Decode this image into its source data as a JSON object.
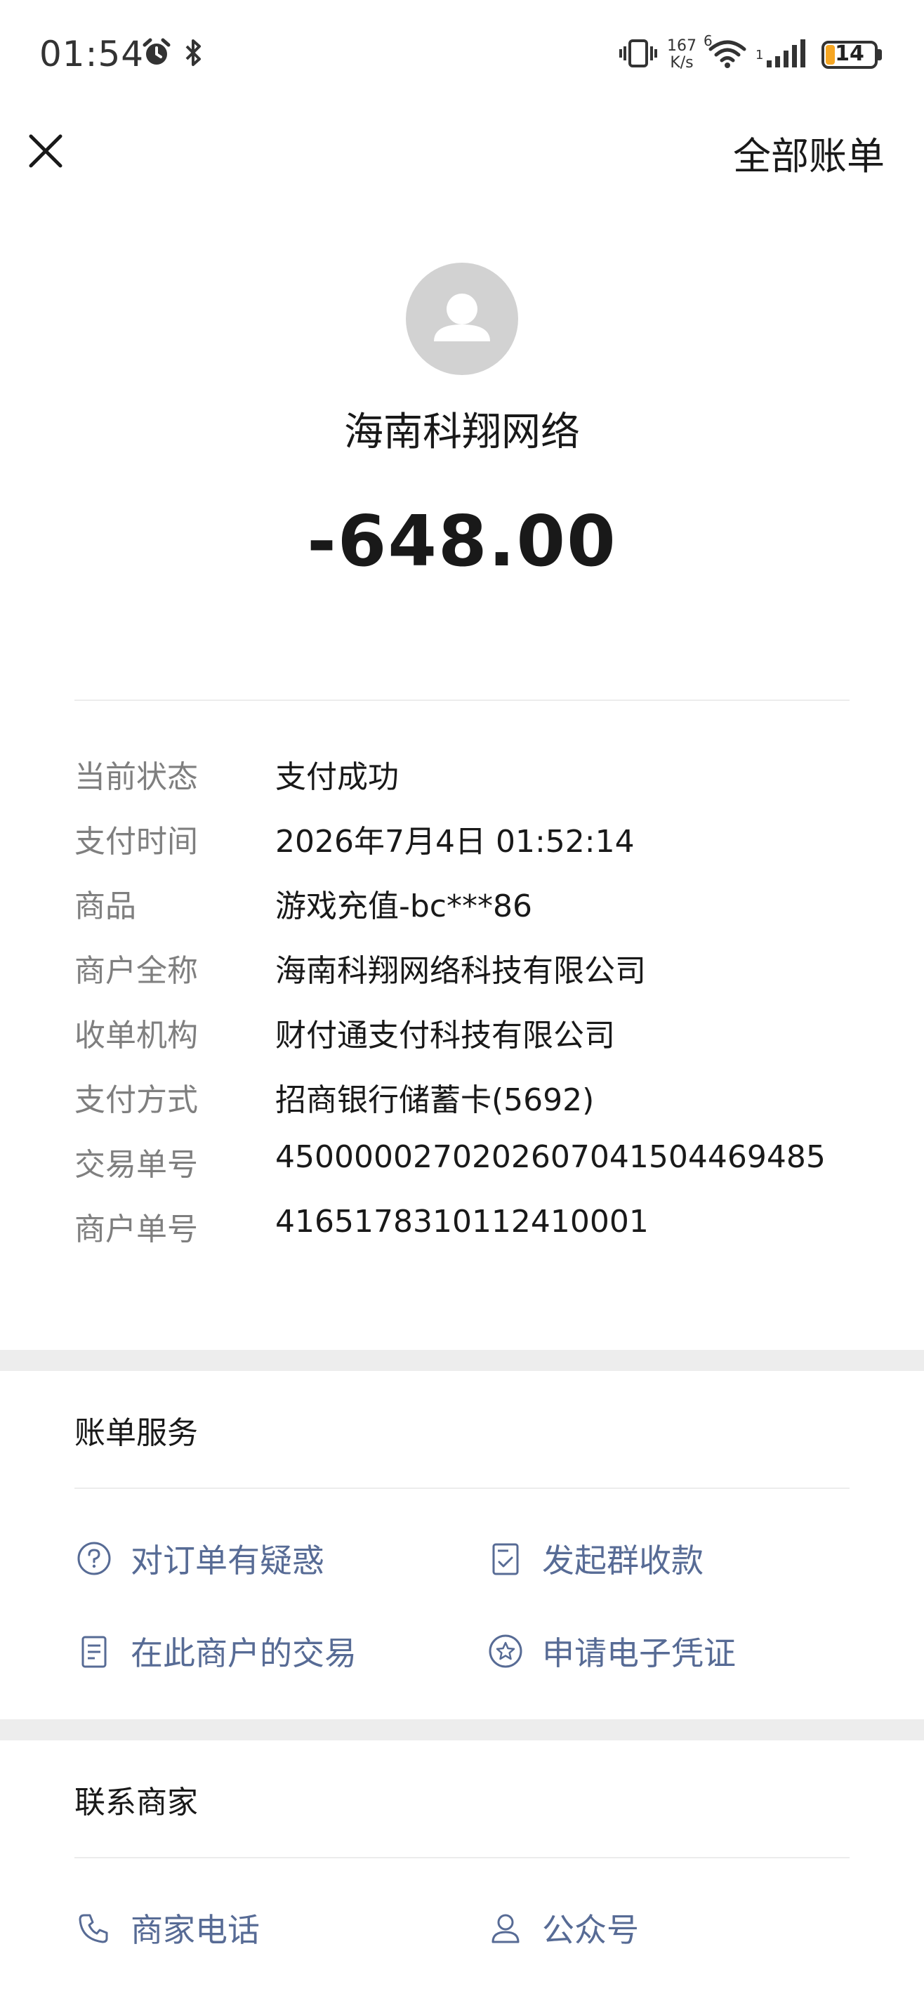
{
  "status_bar": {
    "time": "01:54",
    "net_speed_value": "167",
    "net_speed_unit": "K/s",
    "wifi_label": "6",
    "signal_label": "1",
    "battery_level": "14"
  },
  "header": {
    "all_bills_label": "全部账单"
  },
  "merchant": {
    "name": "海南科翔网络",
    "amount": "-648.00"
  },
  "details": [
    {
      "label": "当前状态",
      "value": "支付成功"
    },
    {
      "label": "支付时间",
      "value": "2026年7月4日 01:52:14"
    },
    {
      "label": "商品",
      "value": "游戏充值-bc***86"
    },
    {
      "label": "商户全称",
      "value": "海南科翔网络科技有限公司"
    },
    {
      "label": "收单机构",
      "value": "财付通支付科技有限公司"
    },
    {
      "label": "支付方式",
      "value": "招商银行储蓄卡(5692)"
    },
    {
      "label": "交易单号",
      "value": "4500000270202607041504469485"
    },
    {
      "label": "商户单号",
      "value": "4165178310112410001"
    }
  ],
  "bill_services": {
    "title": "账单服务",
    "order_question": "对订单有疑惑",
    "group_collect": "发起群收款",
    "merchant_transactions": "在此商户的交易",
    "e_voucher": "申请电子凭证"
  },
  "contact": {
    "title": "联系商家",
    "phone": "商家电话",
    "official_account": "公众号"
  },
  "colors": {
    "link": "#576b95",
    "label_gray": "#7f7f7f",
    "battery": "#f5a623"
  }
}
